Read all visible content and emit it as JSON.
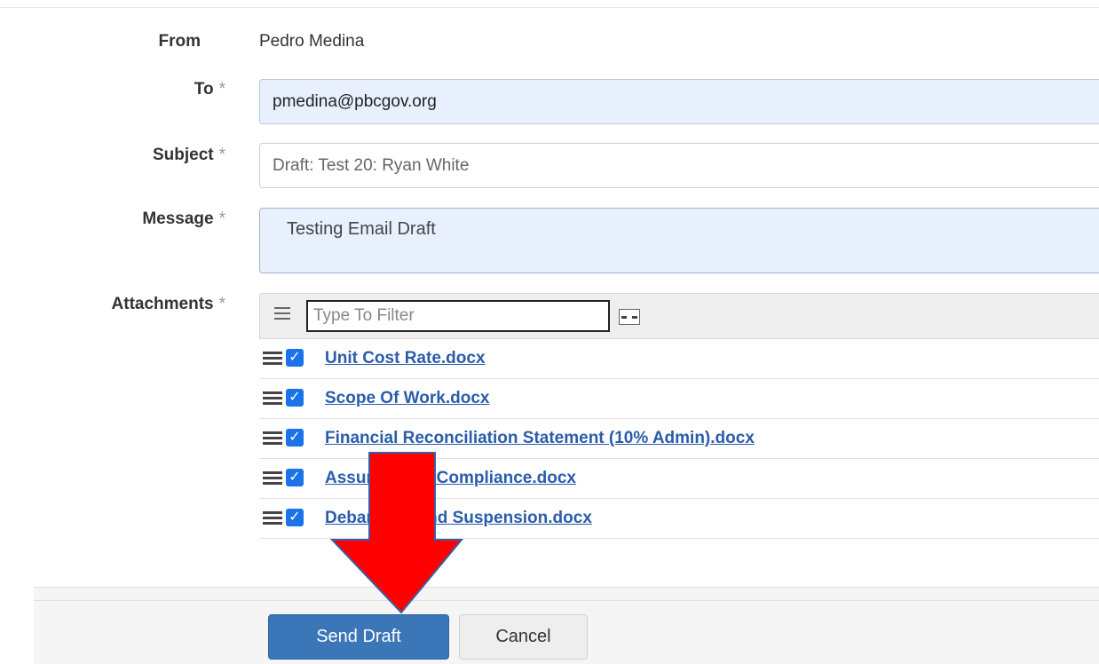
{
  "form": {
    "from_label": "From",
    "from_value": "Pedro Medina",
    "to_label": "To",
    "to_value": "pmedina@pbcgov.org",
    "subject_label": "Subject",
    "subject_value": "Draft: Test 20: Ryan White",
    "message_label": "Message",
    "message_value": "Testing Email Draft",
    "attachments_label": "Attachments",
    "required_marker": "*"
  },
  "attachments": {
    "filter_placeholder": "Type To Filter",
    "items": [
      {
        "name": "Unit Cost Rate.docx",
        "checked": true
      },
      {
        "name": "Scope Of Work.docx",
        "checked": true
      },
      {
        "name": "Financial Reconciliation Statement (10% Admin).docx",
        "checked": true
      },
      {
        "name": "Assurance of Compliance.docx",
        "checked": true
      },
      {
        "name": "Debarment and Suspension.docx",
        "checked": true
      }
    ]
  },
  "footer": {
    "send_label": "Send Draft",
    "cancel_label": "Cancel"
  },
  "colors": {
    "primary_button": "#3a76b8",
    "link": "#2a5cab",
    "checkbox": "#1a73e8",
    "annotation_arrow": "#e00000"
  },
  "icons": [
    "hamburger-icon",
    "checkbox-checked-icon",
    "expand-icon",
    "red-arrow-annotation"
  ]
}
